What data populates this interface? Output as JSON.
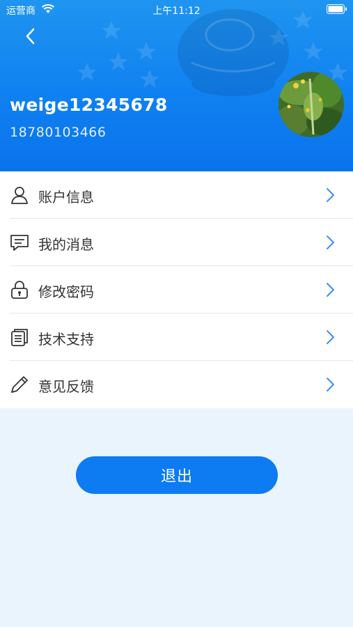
{
  "status_bar": {
    "carrier": "运营商",
    "time": "上午11:12"
  },
  "profile": {
    "username": "weige12345678",
    "phone": "18780103466"
  },
  "menu": [
    {
      "label": "账户信息",
      "icon": "user-icon"
    },
    {
      "label": "我的消息",
      "icon": "message-icon"
    },
    {
      "label": "修改密码",
      "icon": "lock-icon"
    },
    {
      "label": "技术支持",
      "icon": "document-icon"
    },
    {
      "label": "意见反馈",
      "icon": "pencil-icon"
    }
  ],
  "logout_label": "退出",
  "colors": {
    "primary": "#0d7bf2",
    "chevron": "#3d8ef0",
    "background": "#eaf4fc"
  }
}
